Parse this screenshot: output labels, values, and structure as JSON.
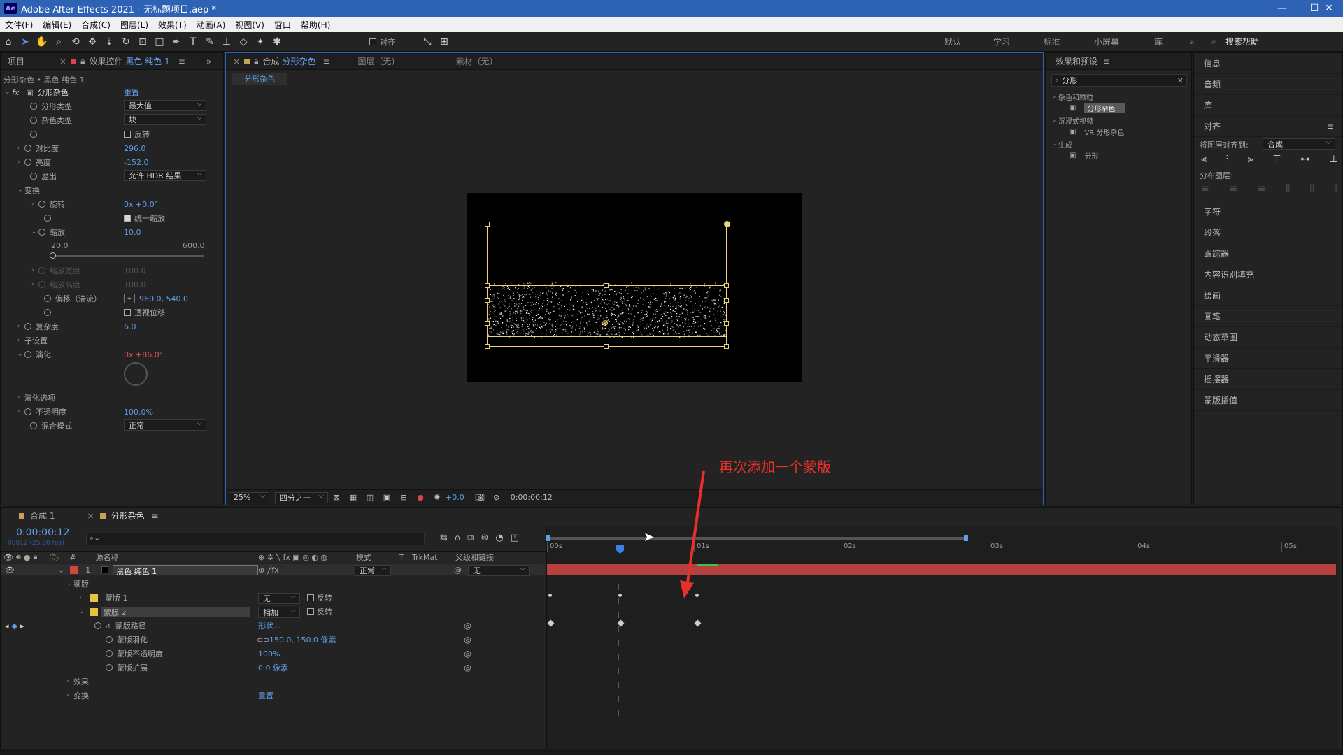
{
  "title": "Adobe After Effects 2021 - 无标题项目.aep *",
  "app_icon": "Ae",
  "menu": [
    "文件(F)",
    "编辑(E)",
    "合成(C)",
    "图层(L)",
    "效果(T)",
    "动画(A)",
    "视图(V)",
    "窗口",
    "帮助(H)"
  ],
  "toolbar": {
    "align_label": "对齐",
    "workspaces": [
      "默认",
      "学习",
      "标准",
      "小屏幕",
      "库"
    ],
    "search_help": "搜索帮助"
  },
  "project_panel": {
    "tab": "项目"
  },
  "effect_controls": {
    "tab_prefix": "效果控件",
    "tab_layer": "黑色 纯色 1",
    "breadcrumb": "分形杂色 • 黑色 纯色 1",
    "fx_label": "fx",
    "effect_name": "分形杂色",
    "reset": "重置",
    "props": {
      "fractal_type": {
        "label": "分形类型",
        "value": "最大值"
      },
      "noise_type": {
        "label": "杂色类型",
        "value": "块"
      },
      "invert": {
        "label": "反转"
      },
      "contrast": {
        "label": "对比度",
        "value": "296.0"
      },
      "brightness": {
        "label": "亮度",
        "value": "-152.0"
      },
      "overflow": {
        "label": "溢出",
        "value": "允许 HDR 结果"
      },
      "transform": {
        "label": "变换"
      },
      "rotation": {
        "label": "旋转",
        "value": "0x +0.0°"
      },
      "uniform_scale": {
        "label": "统一缩放"
      },
      "scale": {
        "label": "缩放",
        "value": "10.0"
      },
      "scale_min": "20.0",
      "scale_max": "600.0",
      "scale_width": {
        "label": "缩放宽度",
        "value": "100.0"
      },
      "scale_height": {
        "label": "缩放高度",
        "value": "100.0"
      },
      "offset": {
        "label": "偏移（湍流）",
        "value": "960.0, 540.0"
      },
      "perspective": {
        "label": "透视位移"
      },
      "complexity": {
        "label": "复杂度",
        "value": "6.0"
      },
      "sub_settings": {
        "label": "子设置"
      },
      "evolution": {
        "label": "演化",
        "value": "0x +86.0°"
      },
      "evolution_options": {
        "label": "演化选项"
      },
      "opacity": {
        "label": "不透明度",
        "value": "100.0%"
      },
      "blend_mode": {
        "label": "混合模式",
        "value": "正常"
      }
    }
  },
  "comp_panel": {
    "tab_prefix": "合成",
    "tab_comp": "分形杂色",
    "layer_tab": "图层（无）",
    "footage_tab": "素材（无）",
    "sub_tab": "分形杂色",
    "zoom": "25%",
    "resolution": "四分之一",
    "exposure": "+0.0",
    "timecode": "0:00:00:12"
  },
  "effects_presets": {
    "title": "效果和预设",
    "search": "分形",
    "groups": [
      {
        "name": "杂色和颗粒",
        "items": [
          "分形杂色"
        ]
      },
      {
        "name": "沉浸式视频",
        "items": [
          "VR 分形杂色"
        ]
      },
      {
        "name": "生成",
        "items": [
          "分形"
        ]
      }
    ]
  },
  "right_panel": {
    "info": "信息",
    "audio": "音频",
    "library": "库",
    "align": "对齐",
    "align_to_label": "将图层对齐到:",
    "align_to_value": "合成",
    "distribute": "分布图层:",
    "items": [
      "字符",
      "段落",
      "跟踪器",
      "内容识别填充",
      "绘画",
      "画笔",
      "动态草图",
      "平滑器",
      "摇摆器",
      "蒙版插值"
    ]
  },
  "timeline": {
    "tab1": "合成 1",
    "tab2": "分形杂色",
    "timecode": "0:00:00:12",
    "fps": "00012 (25.00 fps)",
    "col_source": "源名称",
    "col_mode": "模式",
    "col_t": "T",
    "col_trkmat": "TrkMat",
    "col_parent": "父级和链接",
    "layer_num": "1",
    "layer_name": "黑色 纯色 1",
    "layer_mode": "正常",
    "layer_parent": "无",
    "masks_label": "蒙版",
    "mask1": {
      "name": "蒙版 1",
      "mode": "无",
      "invert": "反转"
    },
    "mask2": {
      "name": "蒙版 2",
      "mode": "相加",
      "invert": "反转"
    },
    "mask_path": {
      "label": "蒙版路径",
      "value": "形状..."
    },
    "mask_feather": {
      "label": "蒙版羽化",
      "value": "150.0, 150.0 像素"
    },
    "mask_opacity": {
      "label": "蒙版不透明度",
      "value": "100%"
    },
    "mask_expansion": {
      "label": "蒙版扩展",
      "value": "0.0 像素"
    },
    "effects_label": "效果",
    "transform_label": "变换",
    "transform_reset": "重置",
    "ruler": [
      "00s",
      "01s",
      "02s",
      "03s",
      "04s",
      "05s"
    ]
  },
  "annotation": {
    "text": "再次添加一个蒙版",
    "color": "#e8302a"
  },
  "colors": {
    "layer_bar": "#b5403e",
    "accent": "#2d62b4",
    "mask_yellow": "#e8c23a"
  }
}
